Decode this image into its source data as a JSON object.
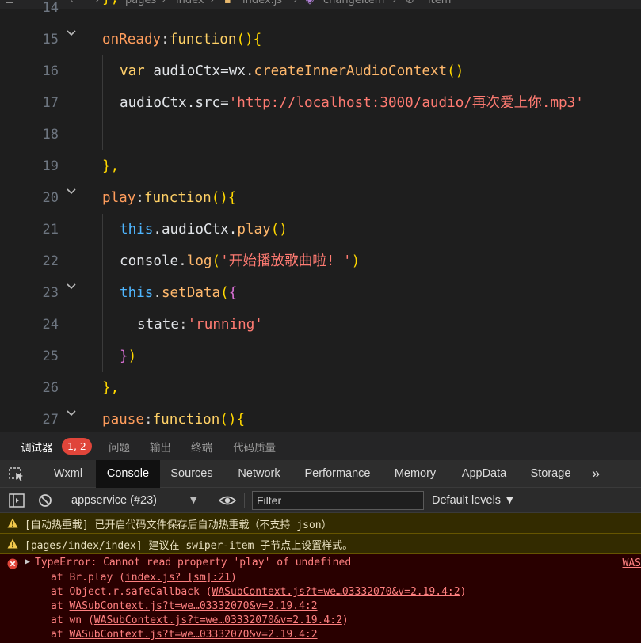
{
  "breadcrumb": {
    "items": [
      "pages",
      "index",
      "index.js",
      "changeItem",
      "item"
    ]
  },
  "editor": {
    "line_numbers": [
      "14",
      "15",
      "16",
      "17",
      "18",
      "19",
      "20",
      "21",
      "22",
      "23",
      "24",
      "25",
      "26",
      "27"
    ],
    "code": {
      "l14_close": "},",
      "l15_key": "onReady",
      "l15_colon": ":",
      "l15_fn": "function",
      "l15_paren": "(){",
      "l16_var": "var",
      "l16_ident": " audioCtx=",
      "l16_wx": "wx",
      "l16_dot": ".",
      "l16_method": "createInnerAudioContext",
      "l16_parens": "()",
      "l17_ident": "audioCtx.src=",
      "l17_q1": "'",
      "l17_url": "http://localhost:3000/audio/再次爱上你.mp3",
      "l17_q2": "'",
      "l19_close": "},",
      "l20_key": "play",
      "l20_colon": ":",
      "l20_fn": "function",
      "l20_paren": "(){",
      "l21_this": "this",
      "l21_rest": ".audioCtx.",
      "l21_method": "play",
      "l21_parens": "()",
      "l22_console": "console",
      "l22_dot": ".",
      "l22_method": "log",
      "l22_open": "(",
      "l22_str": "'开始播放歌曲啦! '",
      "l22_close": ")",
      "l23_this": "this",
      "l23_dot": ".",
      "l23_method": "setData",
      "l23_open": "(",
      "l23_brace": "{",
      "l24_key": "state",
      "l24_colon": ":",
      "l24_str": "'running'",
      "l25_brace": "}",
      "l25_paren": ")",
      "l26_close": "},",
      "l27_key": "pause",
      "l27_colon": ":",
      "l27_fn": "function",
      "l27_paren": "(){"
    }
  },
  "panel_tabs": {
    "debugger": "调试器",
    "badge": "1, 2",
    "issues": "问题",
    "output": "输出",
    "terminal": "终端",
    "code_quality": "代码质量"
  },
  "devtools_tabs": [
    "Wxml",
    "Console",
    "Sources",
    "Network",
    "Performance",
    "Memory",
    "AppData",
    "Storage"
  ],
  "devtools_more": "»",
  "toolbar": {
    "context": "appservice (#23)",
    "context_caret": "▼",
    "filter_placeholder": "Filter",
    "levels": "Default levels ▼"
  },
  "console": {
    "warn1": "[自动热重载] 已开启代码文件保存后自动热重载（不支持 json）",
    "warn2": "[pages/index/index]  建议在 swiper-item 子节点上设置样式。",
    "error": {
      "title": "TypeError: Cannot read property 'play' of undefined",
      "source": "WAS",
      "stack": [
        {
          "pre": "at Br.play (",
          "link": "index.js? [sm]:21",
          "post": ")"
        },
        {
          "pre": "at Object.r.safeCallback (",
          "link": "WASubContext.js?t=we…03332070&v=2.19.4:2",
          "post": ")"
        },
        {
          "pre": "at ",
          "link": "WASubContext.js?t=we…03332070&v=2.19.4:2",
          "post": ""
        },
        {
          "pre": "at wn (",
          "link": "WASubContext.js?t=we…03332070&v=2.19.4:2",
          "post": ")"
        },
        {
          "pre": "at ",
          "link": "WASubContext.js?t=we…03332070&v=2.19.4:2",
          "post": ""
        }
      ]
    }
  },
  "colors": {
    "editor_bg": "#1e1e1e",
    "error_badge": "#e0453a",
    "warn_bg": "#332b00",
    "error_bg": "#290000"
  }
}
